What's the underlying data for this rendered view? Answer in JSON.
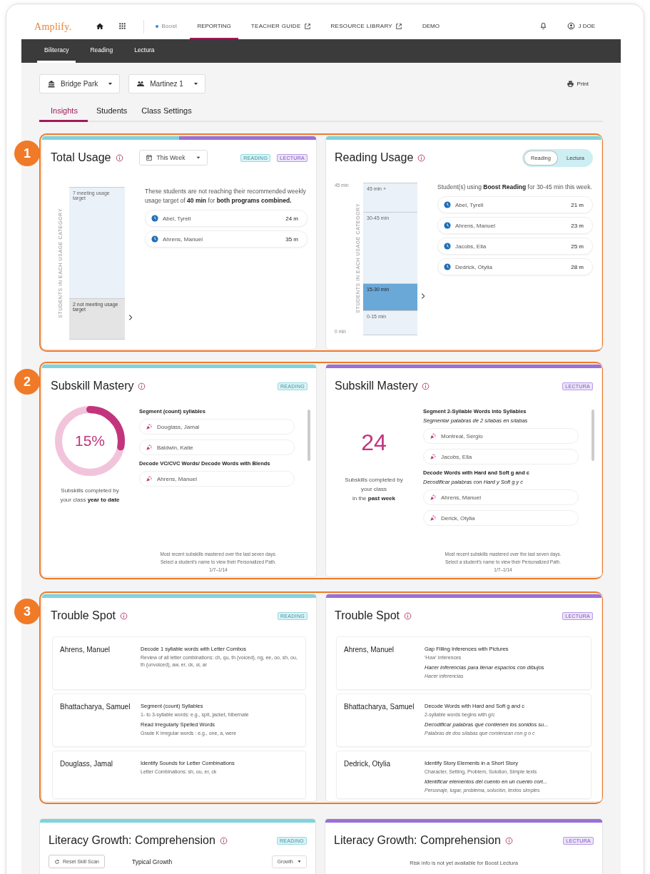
{
  "nav": {
    "logo": "Amplify.",
    "items": [
      {
        "kind": "home",
        "selected": false
      },
      {
        "kind": "apps",
        "selected": false
      },
      {
        "kind": "program",
        "label": "Boost",
        "selected": false
      },
      {
        "kind": "text",
        "label": "REPORTING",
        "selected": true
      },
      {
        "kind": "external",
        "label": "TEACHER GUIDE",
        "selected": false
      },
      {
        "kind": "external",
        "label": "RESOURCE LIBRARY",
        "selected": false
      },
      {
        "kind": "text",
        "label": "DEMO",
        "selected": false
      }
    ],
    "user": "J DOE"
  },
  "subnav": [
    {
      "label": "Biliteracy",
      "selected": true
    },
    {
      "label": "Reading",
      "selected": false
    },
    {
      "label": "Lectura",
      "selected": false
    }
  ],
  "filters": [
    {
      "kind": "school",
      "label": "Bridge Park"
    },
    {
      "kind": "class",
      "label": "Martinez 1"
    }
  ],
  "print": "Print",
  "tabs": [
    {
      "label": "Insights",
      "selected": true
    },
    {
      "label": "Students",
      "selected": false
    },
    {
      "label": "Class Settings",
      "selected": false
    }
  ],
  "sections": [
    {
      "number": "1",
      "cards": [
        {
          "kind": "total-usage",
          "accents": [
            {
              "color": "#7fd3dc"
            },
            {
              "color": "#9b6fd6"
            }
          ],
          "title": "Total Usage",
          "period": "This Week",
          "badges": [
            {
              "label": "READING",
              "kind": "reading"
            },
            {
              "label": "LECTURA",
              "kind": "lectura"
            }
          ],
          "axis_title": "STUDENTS IN EACH USAGE CATEGORY",
          "segments": [
            {
              "label": "7 meeting usage target",
              "selected": false
            },
            {
              "label": "2 not meeting usage target",
              "selected": true
            }
          ],
          "description": "These students are not reaching their recommended weekly usage target of **40 min** for **both programs combined.**",
          "students": [
            {
              "name": "Abel, Tyrell",
              "minutes": "24 m"
            },
            {
              "name": "Ahrens, Manuel",
              "minutes": "35 m"
            }
          ]
        },
        {
          "kind": "program-usage",
          "accents": [
            {
              "color": "#7fd3dc"
            }
          ],
          "title": "Reading Usage",
          "toggle": [
            {
              "label": "Reading",
              "selected": true
            },
            {
              "label": "Lectura",
              "selected": false
            }
          ],
          "ticks": [
            "45 min",
            "0 min"
          ],
          "axis_title": "STUDENTS IN EACH USAGE CATEGORY",
          "segments": [
            {
              "label": "45 min +",
              "selected": false
            },
            {
              "label": "30-45 min",
              "selected": false
            },
            {
              "label": "15-30 min",
              "selected": true
            },
            {
              "label": "0-15 min",
              "selected": false
            }
          ],
          "description": "Student(s) using **Boost Reading** for 30-45 min this week.",
          "students": [
            {
              "name": "Abel, Tyrell",
              "minutes": "21 m"
            },
            {
              "name": "Ahrens, Manuel",
              "minutes": "23 m"
            },
            {
              "name": "Jacobs, Ella",
              "minutes": "25 m"
            },
            {
              "name": "Dedrick, Otylia",
              "minutes": "28 m"
            }
          ]
        }
      ]
    },
    {
      "number": "2",
      "cards": [
        {
          "kind": "mastery-percent",
          "accents": [
            {
              "color": "#7fd3dc"
            }
          ],
          "title": "Subskill Mastery",
          "badges": [
            {
              "label": "READING",
              "kind": "reading"
            }
          ],
          "value": "15%",
          "level": 0.28,
          "caption": "Subskills completed by\nyour class **year to date**",
          "groups": [
            {
              "lines": [
                {
                  "kind": "name",
                  "text": "Segment (count) syllables"
                }
              ],
              "students": [
                "Douglass, Jamal",
                "Baldwin, Katie"
              ]
            },
            {
              "lines": [
                {
                  "kind": "name",
                  "text": "Decode VC/CVC Words/ Decode Words with Blends"
                }
              ],
              "students": [
                "Ahrens, Manuel"
              ]
            }
          ],
          "footer": [
            "Most recent subskills mastered over the last seven days.",
            "Select a student's name to view their Personalized Path.",
            "1/7–1/14"
          ]
        },
        {
          "kind": "mastery-count",
          "accents": [
            {
              "color": "#9b6fd6"
            }
          ],
          "title": "Subskill Mastery",
          "badges": [
            {
              "label": "LECTURA",
              "kind": "lectura"
            }
          ],
          "value": "24",
          "caption": "Subskills completed by\nyour class\nin the **past week**",
          "groups": [
            {
              "lines": [
                {
                  "kind": "name",
                  "text": "Segment 2-Syllable Words into Syllables"
                },
                {
                  "kind": "name-es",
                  "text": "Segmentar palabras de 2 sílabas en sílabas"
                }
              ],
              "students": [
                "Montreal, Sergio",
                "Jacobs, Ella"
              ]
            },
            {
              "lines": [
                {
                  "kind": "name",
                  "text": "Decode Words with Hard and Soft g and c"
                },
                {
                  "kind": "name-es",
                  "text": "Decodificar palabras con Hard y Soft g y c"
                }
              ],
              "students": [
                "Ahrens, Manuel",
                "Derick, Otylia"
              ]
            }
          ],
          "footer": [
            "Most recent subskills mastered over the last seven days.",
            "Select a student's name to view their Personalized Path.",
            "1/7–1/14"
          ]
        }
      ]
    },
    {
      "number": "3",
      "cards": [
        {
          "kind": "trouble-spot",
          "accents": [
            {
              "color": "#7fd3dc"
            }
          ],
          "title": "Trouble Spot",
          "badges": [
            {
              "label": "READING",
              "kind": "reading"
            }
          ],
          "rows": [
            {
              "student": "Ahrens, Manuel",
              "lines": [
                {
                  "kind": "name",
                  "text": "Decode 1 syllable words with Letter Combos"
                },
                {
                  "kind": "detail",
                  "text": "Review of all letter combinations: ch, qu, th (voiced), ng, ee, oo, sh, ou, th (unvoiced), aw, er, ck, oi, ar"
                }
              ]
            },
            {
              "student": "Bhattacharya, Samuel",
              "lines": [
                {
                  "kind": "name",
                  "text": "Segment (count) Syllables"
                },
                {
                  "kind": "detail",
                  "text": "1- to 3-syllable words: e.g., spit, jacket, hibernate"
                },
                {
                  "kind": "name",
                  "text": "Read Irregularly Spelled Words"
                },
                {
                  "kind": "detail",
                  "text": "Grade K irregular words : e.g., one, a, were"
                }
              ]
            },
            {
              "student": "Douglass, Jamal",
              "lines": [
                {
                  "kind": "name",
                  "text": "Identify Sounds for Letter Combinations"
                },
                {
                  "kind": "detail",
                  "text": "Letter Combinations: sh, ou, er, ck"
                }
              ]
            }
          ]
        },
        {
          "kind": "trouble-spot",
          "accents": [
            {
              "color": "#9b6fd6"
            }
          ],
          "title": "Trouble Spot",
          "badges": [
            {
              "label": "LECTURA",
              "kind": "lectura"
            }
          ],
          "rows": [
            {
              "student": "Ahrens, Manuel",
              "lines": [
                {
                  "kind": "name",
                  "text": "Gap Filling Inferences with Pictures"
                },
                {
                  "kind": "detail",
                  "text": "'How' Inferences"
                },
                {
                  "kind": "name-es",
                  "text": "Hacer inferencias para llenar espacios con dibujos"
                },
                {
                  "kind": "detail-es",
                  "text": "Hacer inferencias"
                }
              ]
            },
            {
              "student": "Bhattacharya, Samuel",
              "lines": [
                {
                  "kind": "name",
                  "text": "Decode Words with Hard and Soft g and c"
                },
                {
                  "kind": "detail",
                  "text": "2-syllable words begins with g/c"
                },
                {
                  "kind": "name-es",
                  "text": "Decodificar palabras que contienen los sonidos su..."
                },
                {
                  "kind": "detail-es",
                  "text": "Palabras de dos sílabas que comienzan con g o c"
                }
              ]
            },
            {
              "student": "Dedrick, Otylia",
              "lines": [
                {
                  "kind": "name",
                  "text": "Identify Story Elements in a Short Story"
                },
                {
                  "kind": "detail",
                  "text": "Character, Setting, Problem, Solution, Simple texts"
                },
                {
                  "kind": "name-es",
                  "text": "Identificar elementos del cuento en un cuento cort..."
                },
                {
                  "kind": "detail-es",
                  "text": "Personaje, lugar, problema, solución, textos simples"
                }
              ]
            }
          ]
        }
      ]
    }
  ],
  "growth_cards": [
    {
      "kind": "growth",
      "accents": [
        {
          "color": "#7fd3dc"
        }
      ],
      "title": "Literacy Growth: Comprehension",
      "badges": [
        {
          "label": "READING",
          "kind": "reading"
        }
      ],
      "reset": "Reset Skill Scan",
      "label": "Typical Growth",
      "dropdown": "Growth"
    },
    {
      "kind": "growth-unavailable",
      "accents": [
        {
          "color": "#9b6fd6"
        }
      ],
      "title": "Literacy Growth: Comprehension",
      "badges": [
        {
          "label": "LECTURA",
          "kind": "lectura"
        }
      ],
      "message": "Risk info is not yet available for Boost Lectura"
    }
  ]
}
